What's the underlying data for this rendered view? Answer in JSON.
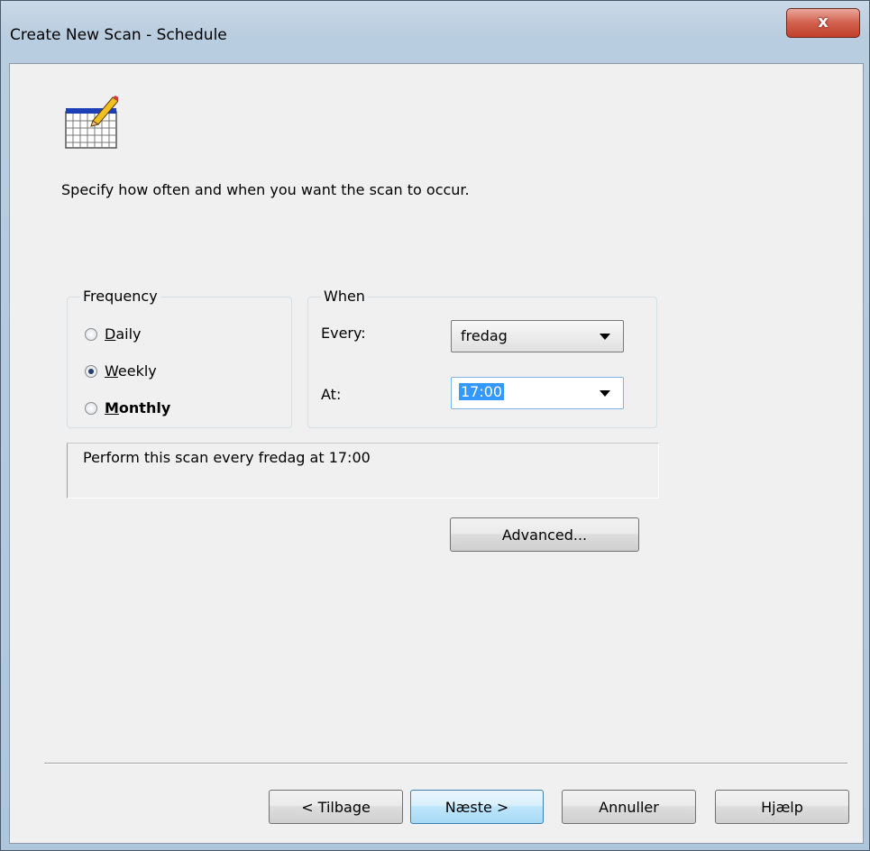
{
  "window": {
    "title": "Create New Scan - Schedule",
    "close_label": "x"
  },
  "description": "Specify how often and when you want the scan to occur.",
  "frequency": {
    "legend": "Frequency",
    "options": [
      {
        "label": "Daily",
        "selected": false
      },
      {
        "label": "Weekly",
        "selected": true
      },
      {
        "label": "Monthly",
        "selected": false
      }
    ]
  },
  "when": {
    "legend": "When",
    "every_label": "Every:",
    "every_value": "fredag",
    "at_label": "At:",
    "at_value": "17:00"
  },
  "summary": "Perform this scan every fredag at 17:00",
  "buttons": {
    "advanced": "Advanced...",
    "back": "< Tilbage",
    "next": "Næste >",
    "cancel": "Annuller",
    "help": "Hjælp"
  },
  "icons": {
    "header_icon": "calendar-pencil-icon"
  }
}
